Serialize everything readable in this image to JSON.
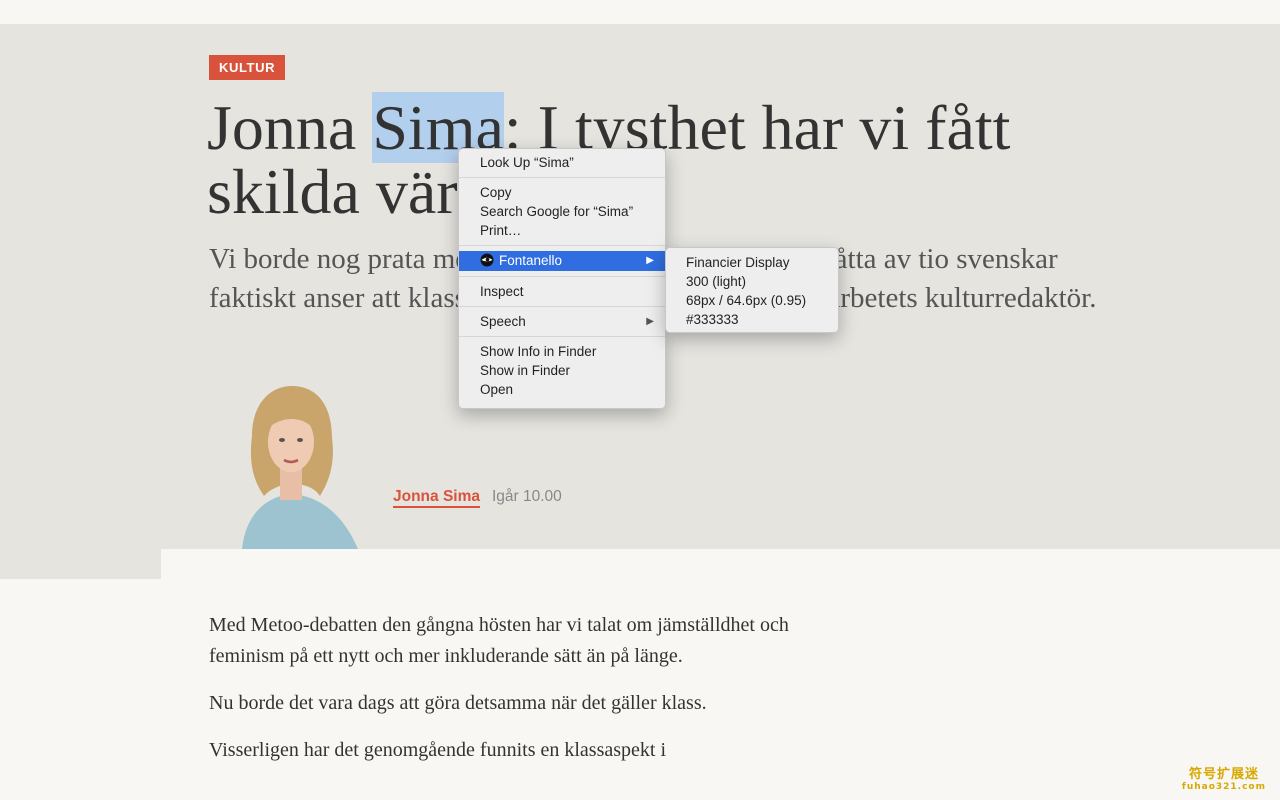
{
  "article": {
    "category": "KULTUR",
    "headline_before": "Jonna ",
    "headline_selected": "Sima",
    "headline_after": ": I tysthet har vi fått skilda världar",
    "lead": "Vi borde nog prata mer om klass. Inte minst eftersom åtta av tio svenskar faktiskt anser att klass spelar roll i vardagen, skriver Arbetets kulturredaktör.",
    "author": "Jonna Sima",
    "published": "Igår 10.00",
    "paragraphs": [
      "Med Metoo-debatten den gångna hösten har vi talat om jämställdhet och feminism på ett nytt och mer inkluderande sätt än på länge.",
      "Nu borde det vara dags att göra detsamma när det gäller klass.",
      "Visserligen har det genomgående funnits en klassaspekt i"
    ]
  },
  "context_menu": {
    "look_up": "Look Up “Sima”",
    "copy": "Copy",
    "search_google": "Search Google for “Sima”",
    "print": "Print…",
    "fontanello": "Fontanello",
    "inspect": "Inspect",
    "speech": "Speech",
    "show_info": "Show Info in Finder",
    "show_in_finder": "Show in Finder",
    "open": "Open",
    "submenu_arrow": "▶"
  },
  "fontanello_info": {
    "family": "Financier Display",
    "weight": "300 (light)",
    "size": "68px / 64.6px (0.95)",
    "color": "#333333"
  },
  "watermark": {
    "line1": "符号扩展迷",
    "line2": "fuhao321.com"
  },
  "colors": {
    "accent": "#d9533c",
    "hero_bg": "#e6e4df",
    "page_bg": "#f8f7f3",
    "selection": "#b3cfee",
    "menu_highlight": "#2f6de0"
  },
  "icons": {
    "fontanello": "fontanello-eye-icon",
    "submenu": "chevron-right-icon"
  }
}
